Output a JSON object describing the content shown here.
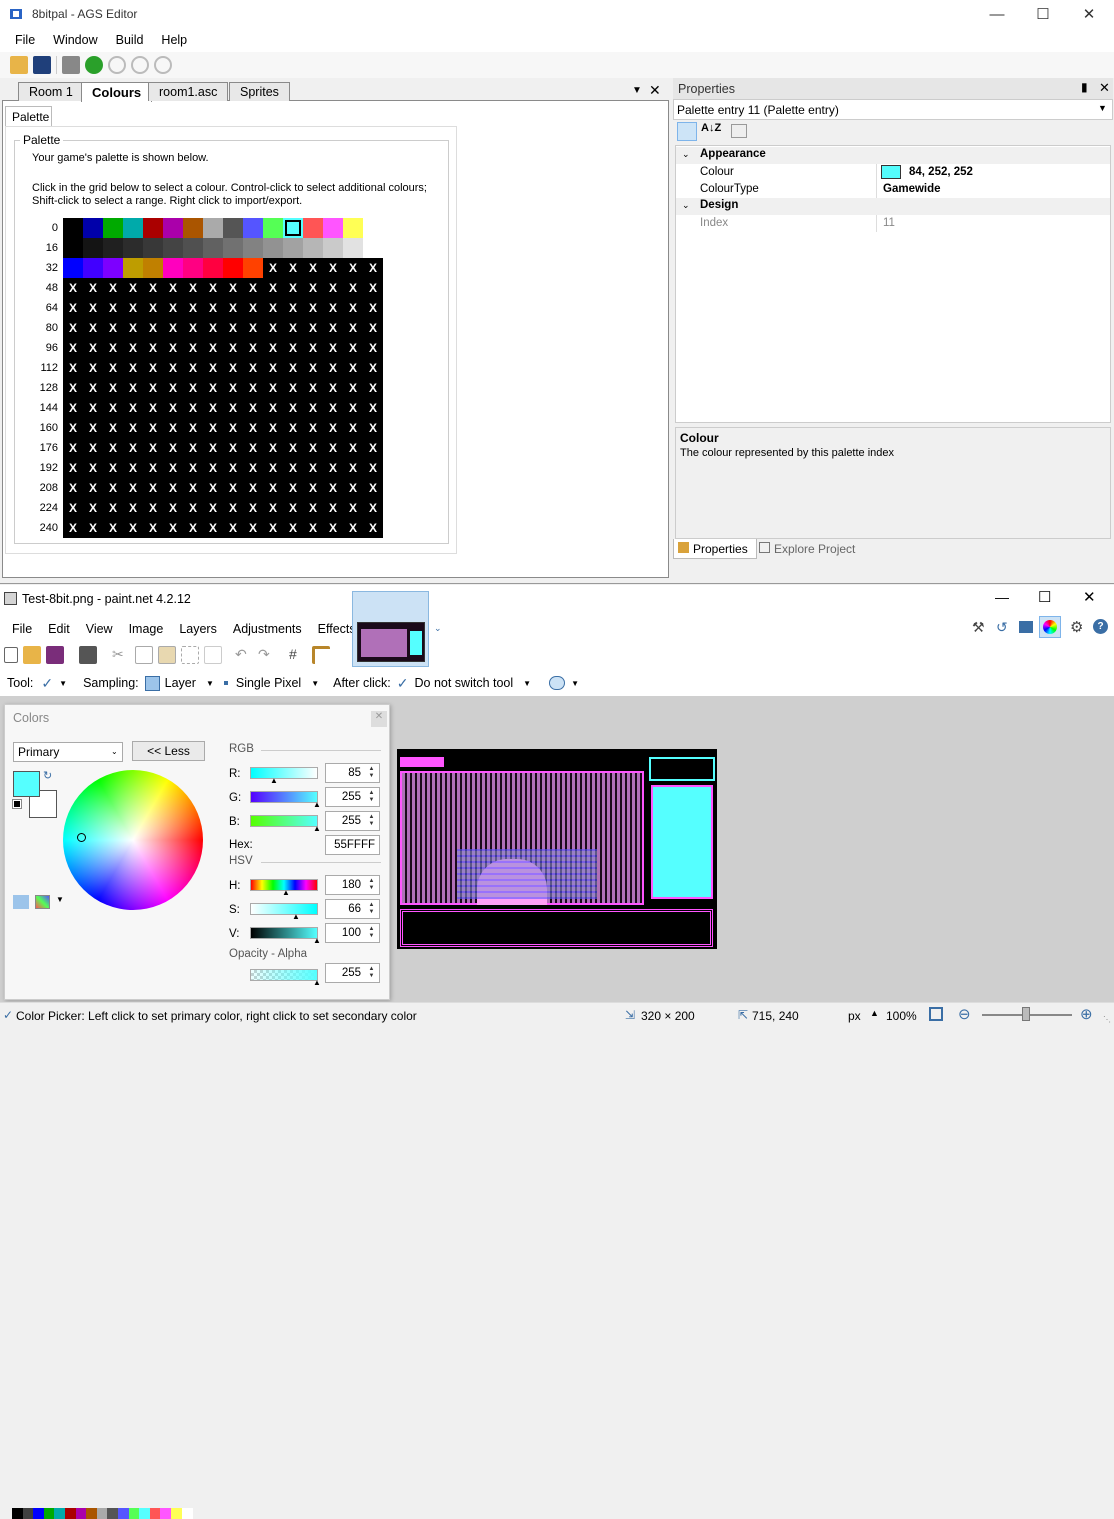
{
  "ags": {
    "title": "8bitpal - AGS Editor",
    "menu": [
      "File",
      "Window",
      "Build",
      "Help"
    ],
    "tabs": [
      "Room 1",
      "Colours",
      "room1.asc",
      "Sprites"
    ],
    "subtab": "Palette",
    "group_title": "Palette",
    "intro": "Your game's palette is shown below.",
    "instructions_1": "Click in the grid below to select a colour. Control-click to select additional colours;",
    "instructions_2": "Shift-click to select a range.  Right click to import/export.",
    "row_labels": [
      "0",
      "16",
      "32",
      "48",
      "64",
      "80",
      "96",
      "112",
      "128",
      "144",
      "160",
      "176",
      "192",
      "208",
      "224",
      "240"
    ],
    "empty_marker": "X",
    "palette_colors": [
      "#000000",
      "#0000aa",
      "#00aa00",
      "#00aaaa",
      "#aa0000",
      "#aa00aa",
      "#aa5500",
      "#aaaaaa",
      "#555555",
      "#5555ff",
      "#55ff55",
      "#55ffff",
      "#ff5555",
      "#ff55ff",
      "#ffff55",
      "#ffffff",
      "#000000",
      "#141414",
      "#202020",
      "#2c2c2c",
      "#383838",
      "#444444",
      "#505050",
      "#616161",
      "#717171",
      "#828282",
      "#929292",
      "#a2a2a2",
      "#b6b6b6",
      "#cacaca",
      "#e2e2e2",
      "#ffffff",
      "#0000ff",
      "#4100ff",
      "#7d00ff",
      "#be9d00",
      "#c08000",
      "#ff00be",
      "#ff0082",
      "#ff0040",
      "#ff0000",
      "#ff4100"
    ],
    "selected_index": 11,
    "properties": {
      "title": "Properties",
      "selector": "Palette entry 11 (Palette entry)",
      "cat_appearance": "Appearance",
      "colour_label": "Colour",
      "colour_value": "84, 252, 252",
      "colour_swatch": "#54fcfc",
      "colourtype_label": "ColourType",
      "colourtype_value": "Gamewide",
      "cat_design": "Design",
      "index_label": "Index",
      "index_value": "11",
      "help_title": "Colour",
      "help_text": "The colour represented by this palette index",
      "bottom_tabs": [
        "Properties",
        "Explore Project"
      ]
    }
  },
  "pdn": {
    "title": "Test-8bit.png - paint.net 4.2.12",
    "menu": [
      "File",
      "Edit",
      "View",
      "Image",
      "Layers",
      "Adjustments",
      "Effects"
    ],
    "toolbar": {
      "tool_label": "Tool:",
      "sampling_label": "Sampling:",
      "sampling_value": "Layer",
      "pixel_mode": "Single Pixel",
      "after_click_label": "After click:",
      "after_click_value": "Do not switch tool"
    },
    "colors_panel": {
      "title": "Colors",
      "mode": "Primary",
      "less_button": "<< Less",
      "rgb_header": "RGB",
      "r_label": "R:",
      "r_value": "85",
      "g_label": "G:",
      "g_value": "255",
      "b_label": "B:",
      "b_value": "255",
      "hex_label": "Hex:",
      "hex_value": "55FFFF",
      "hsv_header": "HSV",
      "h_label": "H:",
      "h_value": "180",
      "s_label": "S:",
      "s_value": "66",
      "v_label": "V:",
      "v_value": "100",
      "opacity_header": "Opacity - Alpha",
      "alpha_value": "255",
      "primary_color": "#55ffff",
      "secondary_color": "#ffffff",
      "swatches": [
        "#000000",
        "#404040",
        "#0000ff",
        "#00aa00",
        "#00aaaa",
        "#aa0000",
        "#aa00aa",
        "#aa5500",
        "#aaaaaa",
        "#555555",
        "#5555ff",
        "#55ff55",
        "#55ffff",
        "#ff5555",
        "#ff55ff",
        "#ffff55",
        "#ffffff"
      ]
    },
    "status": {
      "hint": "Color Picker: Left click to set primary color, right click to set secondary color",
      "image_size": "320 × 200",
      "cursor_pos": "715, 240",
      "unit": "px",
      "zoom": "100%"
    }
  }
}
